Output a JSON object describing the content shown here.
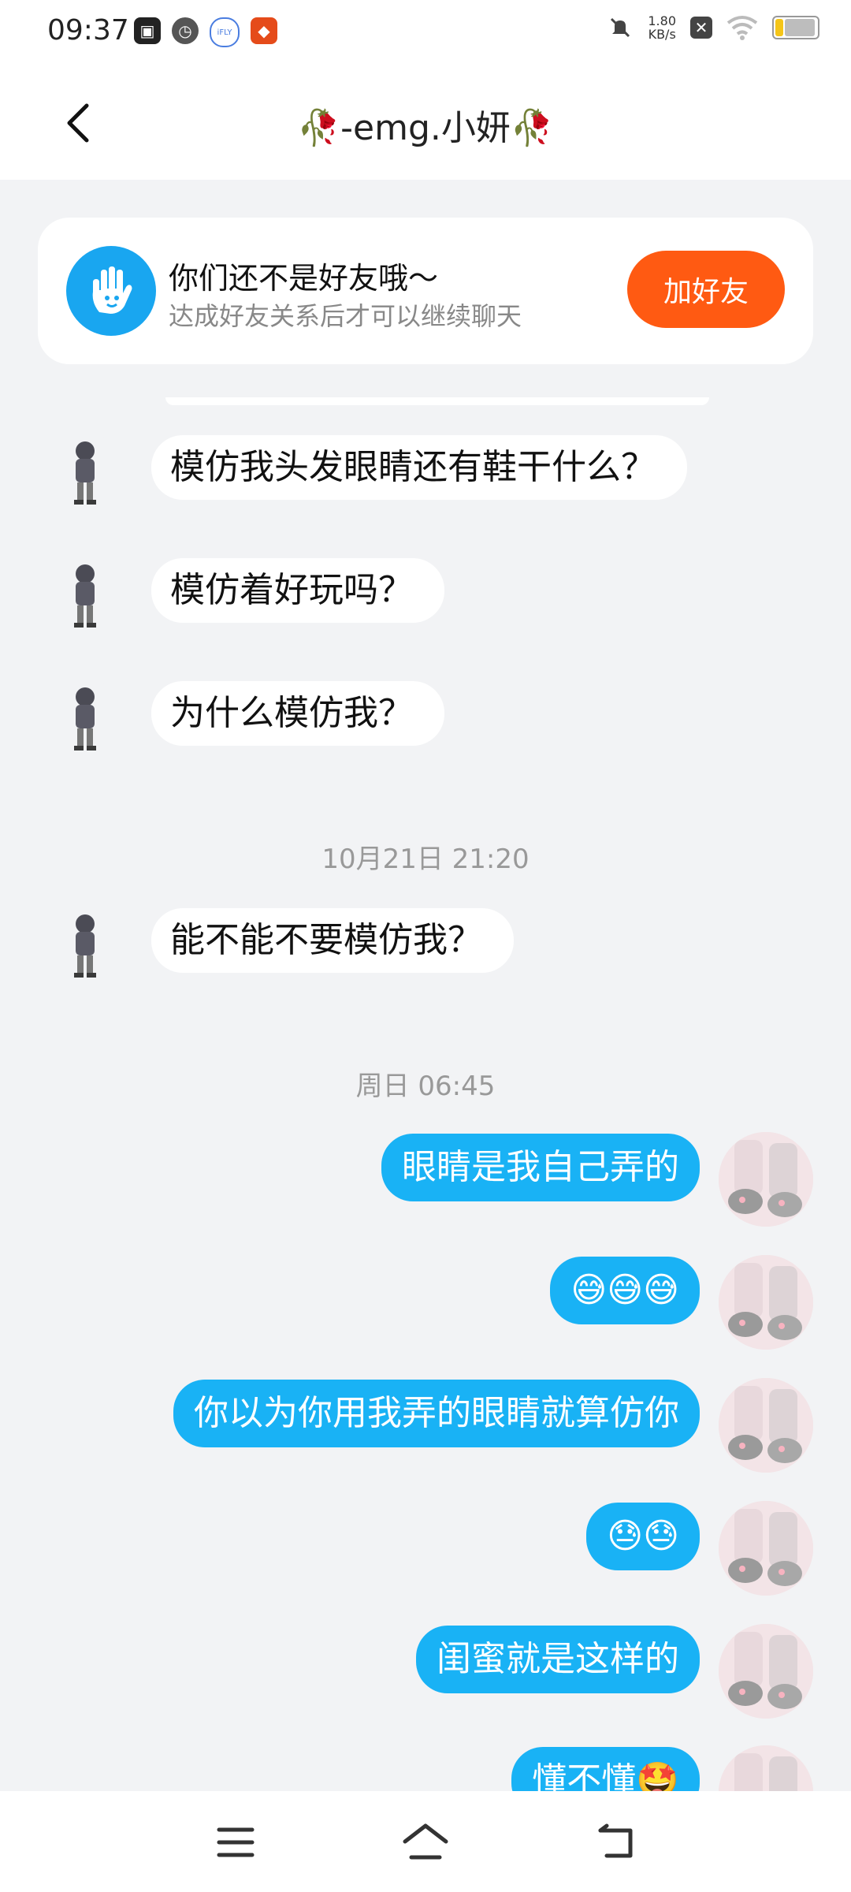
{
  "status_bar": {
    "time": "09:37",
    "net_speed_value": "1.80",
    "net_speed_unit": "KB/s",
    "icons": [
      "app-icon-1",
      "clock-app-icon",
      "ifly-icon",
      "red-app-icon",
      "mute-icon",
      "close-box-icon",
      "wifi-icon",
      "battery-icon"
    ]
  },
  "header": {
    "title": "🥀-emg.小妍🥀",
    "back_icon": "chevron-left-icon"
  },
  "banner": {
    "title": "你们还不是好友哦～",
    "subtitle": "达成好友关系后才可以继续聊天",
    "button_label": "加好友",
    "accent": "#ff5a12",
    "icon_bg": "#19a6f0"
  },
  "messages_left": [
    {
      "text": "模仿我头发眼睛还有鞋干什么？"
    },
    {
      "text": "模仿着好玩吗？"
    },
    {
      "text": "为什么模仿我？"
    },
    {
      "text": "能不能不要模仿我？"
    }
  ],
  "timestamps": [
    "10月21日 21:20",
    "周日 06:45"
  ],
  "messages_right": [
    {
      "text": "眼睛是我自己弄的"
    },
    {
      "text": "😅😅😅"
    },
    {
      "text": "你以为你用我弄的眼睛就算仿你"
    },
    {
      "text": "😓😓"
    },
    {
      "text": "闺蜜就是这样的"
    },
    {
      "text": "懂不懂🤩"
    }
  ],
  "colors": {
    "bubble_right": "#19b2f5",
    "bubble_left": "#ffffff",
    "background": "#f2f3f5"
  },
  "navbar": {
    "icons": [
      "menu-icon",
      "home-icon",
      "back-icon"
    ]
  }
}
